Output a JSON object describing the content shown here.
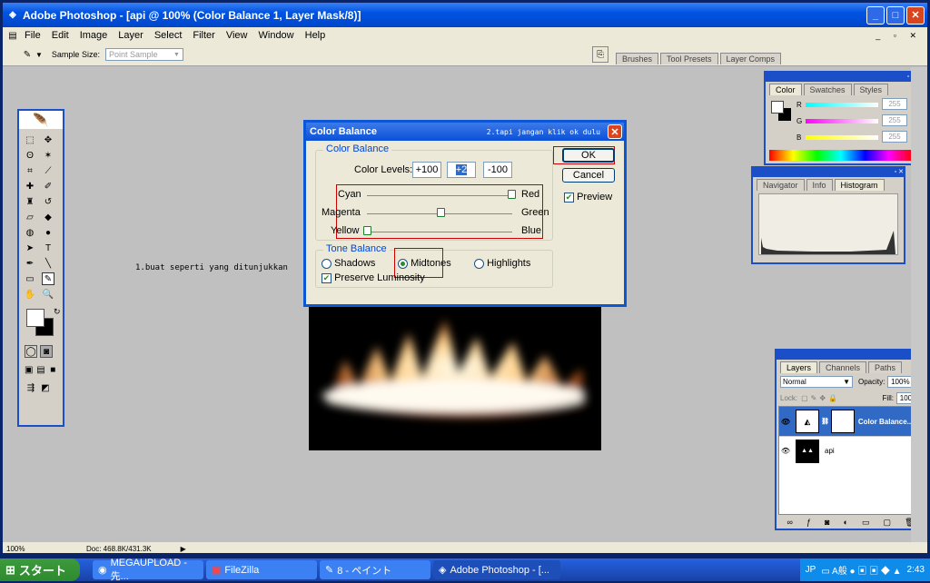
{
  "window": {
    "title": "Adobe Photoshop - [api @ 100% (Color Balance 1, Layer Mask/8)]"
  },
  "menu": [
    "File",
    "Edit",
    "Image",
    "Layer",
    "Select",
    "Filter",
    "View",
    "Window",
    "Help"
  ],
  "options": {
    "sample_size_label": "Sample Size:",
    "sample_size_value": "Point Sample"
  },
  "dock_tabs": [
    "Brushes",
    "Tool Presets",
    "Layer Comps"
  ],
  "annotations": {
    "step1": "1.buat seperti yang ditunjukkan",
    "step2": "2.tapi jangan klik ok dulu"
  },
  "dialog": {
    "title": "Color Balance",
    "group1": "Color Balance",
    "levels_label": "Color Levels:",
    "levels": [
      "+100",
      "+2",
      "-100"
    ],
    "sliders": [
      {
        "left": "Cyan",
        "right": "Red",
        "value": 100
      },
      {
        "left": "Magenta",
        "right": "Green",
        "value": 2
      },
      {
        "left": "Yellow",
        "right": "Blue",
        "value": -100
      }
    ],
    "group2": "Tone Balance",
    "tones": [
      "Shadows",
      "Midtones",
      "Highlights"
    ],
    "selected_tone": "Midtones",
    "preserve": "Preserve Luminosity",
    "ok": "OK",
    "cancel": "Cancel",
    "preview": "Preview"
  },
  "color_panel": {
    "tabs": [
      "Color",
      "Swatches",
      "Styles"
    ],
    "channels": [
      {
        "label": "R",
        "value": "255"
      },
      {
        "label": "G",
        "value": "255"
      },
      {
        "label": "B",
        "value": "255"
      }
    ]
  },
  "nav_panel": {
    "tabs": [
      "Navigator",
      "Info",
      "Histogram"
    ]
  },
  "layers_panel": {
    "tabs": [
      "Layers",
      "Channels",
      "Paths"
    ],
    "blend_mode": "Normal",
    "opacity_label": "Opacity:",
    "opacity": "100%",
    "lock_label": "Lock:",
    "fill_label": "Fill:",
    "fill": "100%",
    "layers": [
      {
        "name": "Color Balance...",
        "selected": true
      },
      {
        "name": "api",
        "selected": false
      }
    ]
  },
  "status": {
    "zoom": "100%",
    "doc": "Doc: 468.8K/431.3K"
  },
  "taskbar": {
    "start": "スタート",
    "tasks": [
      "MEGAUPLOAD - 先...",
      "FileZilla",
      "8 - ペイント",
      "Adobe Photoshop - [..."
    ],
    "lang": "JP",
    "clock": "2:43"
  }
}
